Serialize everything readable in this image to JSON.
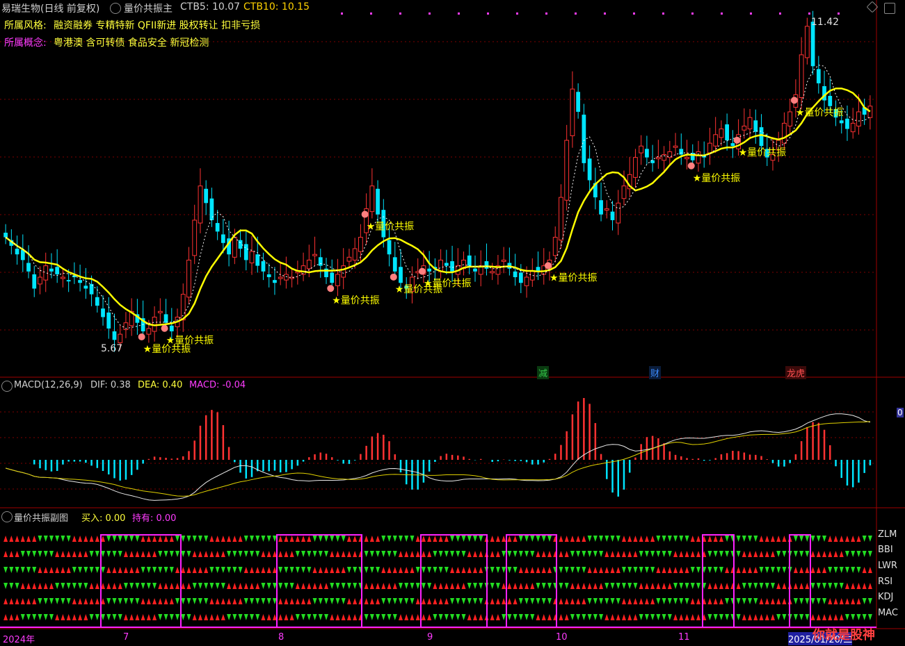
{
  "header": {
    "stock": "易瑞生物(日线 前复权)",
    "indicator": "量价共振主",
    "ctb5_label": "CTB5: 10.07",
    "ctb10_label": "CTB10: 10.15"
  },
  "style_row": {
    "label": "所属风格:",
    "value": "融资融券 专精特新 QFII新进 股权转让 扣非亏损"
  },
  "concept_row": {
    "label": "所属概念:",
    "value": "粤港澳 含可转债 食品安全 新冠检测"
  },
  "annotations": {
    "high": "11.42",
    "low": "5.67",
    "signal_text": "量价共振"
  },
  "event_marks": [
    {
      "text": "减",
      "color": "#34c84a"
    },
    {
      "text": "财",
      "color": "#3c8cff"
    },
    {
      "text": "龙虎",
      "color": "#ff5050"
    }
  ],
  "macd_header": {
    "name": "MACD(12,26,9)",
    "dif": "DIF: 0.38",
    "dea": "DEA: 0.40",
    "macd": "MACD: -0.04",
    "zero_label": "0"
  },
  "sub_header": {
    "name": "量价共振副图",
    "buy": "买入: 0.00",
    "hold": "持有: 0.00"
  },
  "signal_rows": [
    "ZLM",
    "BBI",
    "LWR",
    "RSI",
    "KDJ",
    "MAC"
  ],
  "x_axis": [
    "2024年",
    "7",
    "8",
    "9",
    "10",
    "11",
    "2025/01/20/二"
  ],
  "watermark": "你就是股神",
  "colors": {
    "up": "#ff3232",
    "down": "#00e5ff",
    "ma": "#ffff00",
    "dif": "#e8e8e8",
    "dea": "#e0d000",
    "grid": "#800000",
    "arrow_up": "#ff2020",
    "arrow_down": "#22dd22",
    "magenta": "#ff22ff"
  },
  "chart_data": {
    "type": "candlestick",
    "title": "易瑞生物(日线 前复权)",
    "period": "2024-06 to 2025-01",
    "price_high": 11.42,
    "price_low": 5.67,
    "closes": [
      7.6,
      7.45,
      7.3,
      7.2,
      7.0,
      6.7,
      6.9,
      7.1,
      7.0,
      6.95,
      6.9,
      6.85,
      6.9,
      6.8,
      6.7,
      6.6,
      6.4,
      6.2,
      6.0,
      5.8,
      5.9,
      6.1,
      6.3,
      6.1,
      5.95,
      6.0,
      6.2,
      6.3,
      6.1,
      5.95,
      6.2,
      6.6,
      7.2,
      7.9,
      8.5,
      8.2,
      7.9,
      7.7,
      7.5,
      7.3,
      7.6,
      7.4,
      7.2,
      7.35,
      7.1,
      7.0,
      6.9,
      6.8,
      6.9,
      6.95,
      6.9,
      7.0,
      7.1,
      7.2,
      7.3,
      7.1,
      6.9,
      6.8,
      6.95,
      7.1,
      7.25,
      7.4,
      7.6,
      8.1,
      8.5,
      8.0,
      7.6,
      7.3,
      7.0,
      6.8,
      6.7,
      6.9,
      7.0,
      7.1,
      7.0,
      7.05,
      7.2,
      7.1,
      7.0,
      7.1,
      7.2,
      7.1,
      7.0,
      7.1,
      7.05,
      7.0,
      7.1,
      7.2,
      7.05,
      6.9,
      6.8,
      6.9,
      7.0,
      7.0,
      7.1,
      7.2,
      7.6,
      8.3,
      9.3,
      10.2,
      9.8,
      8.9,
      8.6,
      8.3,
      8.0,
      8.1,
      7.9,
      8.2,
      8.5,
      8.7,
      9.0,
      9.2,
      9.0,
      8.9,
      9.0,
      9.05,
      9.1,
      9.2,
      9.05,
      9.0,
      8.95,
      9.1,
      9.0,
      9.25,
      9.4,
      9.5,
      9.3,
      9.2,
      9.4,
      9.55,
      9.7,
      9.45,
      9.2,
      9.0,
      9.05,
      9.3,
      9.6,
      9.8,
      10.1,
      10.8,
      11.3,
      10.6,
      10.3,
      10.0,
      9.9,
      9.7,
      9.6,
      9.5,
      9.6,
      9.8,
      9.75,
      9.9
    ]
  }
}
